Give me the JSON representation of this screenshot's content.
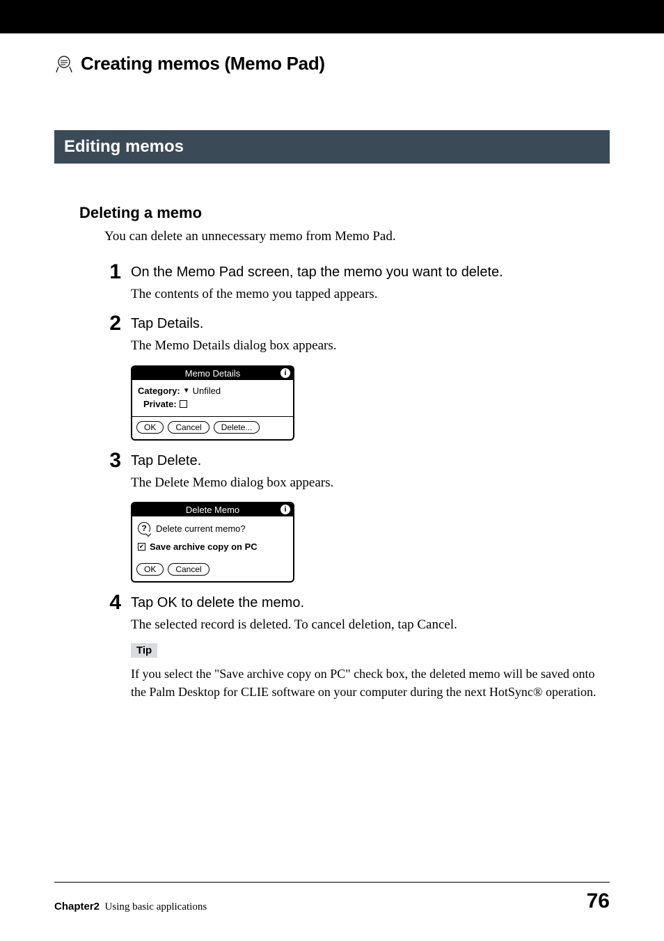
{
  "page_title": "Creating memos (Memo Pad)",
  "section_title": "Editing memos",
  "subheading": "Deleting a memo",
  "intro": "You can delete an unnecessary memo from Memo Pad.",
  "steps": [
    {
      "num": "1",
      "title": "On the Memo Pad screen, tap the memo you want to delete.",
      "body": "The contents of the memo you tapped appears."
    },
    {
      "num": "2",
      "title": "Tap Details.",
      "body": "The Memo Details dialog box appears."
    },
    {
      "num": "3",
      "title": "Tap Delete.",
      "body": "The Delete Memo dialog box appears."
    },
    {
      "num": "4",
      "title": "Tap OK to delete the memo.",
      "body": "The selected record is deleted. To cancel deletion, tap Cancel."
    }
  ],
  "memo_details_dialog": {
    "title": "Memo Details",
    "category_label": "Category:",
    "category_value": "Unfiled",
    "private_label": "Private:",
    "private_checked": false,
    "buttons": {
      "ok": "OK",
      "cancel": "Cancel",
      "delete": "Delete..."
    }
  },
  "delete_memo_dialog": {
    "title": "Delete Memo",
    "question": "Delete current memo?",
    "archive_label": "Save archive copy on PC",
    "archive_checked": true,
    "buttons": {
      "ok": "OK",
      "cancel": "Cancel"
    }
  },
  "tip": {
    "label": "Tip",
    "text": "If you select the \"Save archive copy on PC\" check box, the deleted memo will be saved onto the Palm Desktop for CLIE software on your computer during the next HotSync® operation."
  },
  "footer": {
    "chapter": "Chapter2",
    "title": "Using basic applications",
    "page": "76"
  }
}
